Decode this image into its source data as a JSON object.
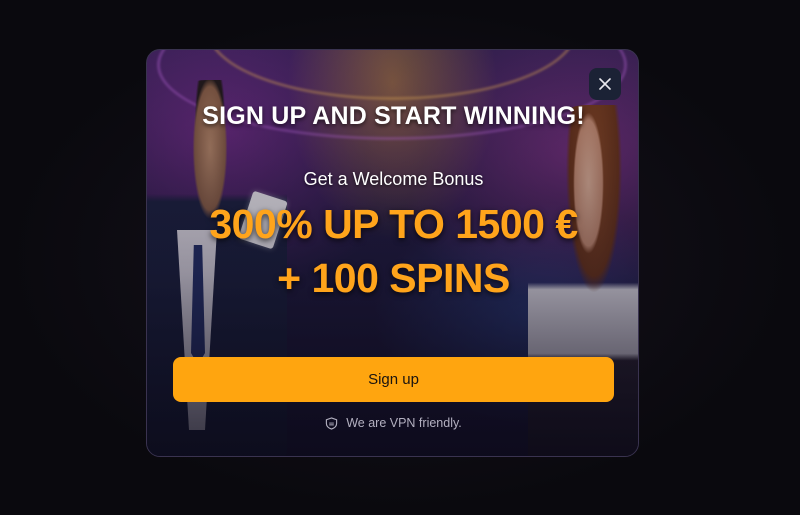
{
  "modal": {
    "headline": "SIGN UP AND START WINNING!",
    "subheadline": "Get a Welcome Bonus",
    "bonus_line_1": "300% UP TO 1500 €",
    "bonus_line_2": "+ 100 SPINS",
    "signup_label": "Sign up",
    "vpn_note": "We are VPN friendly.",
    "close_icon": "close-icon",
    "vpn_icon": "shield-icon"
  },
  "colors": {
    "accent": "#ffa50f",
    "bonus_text": "#ffa41b",
    "close_button_bg": "#1b2235"
  }
}
